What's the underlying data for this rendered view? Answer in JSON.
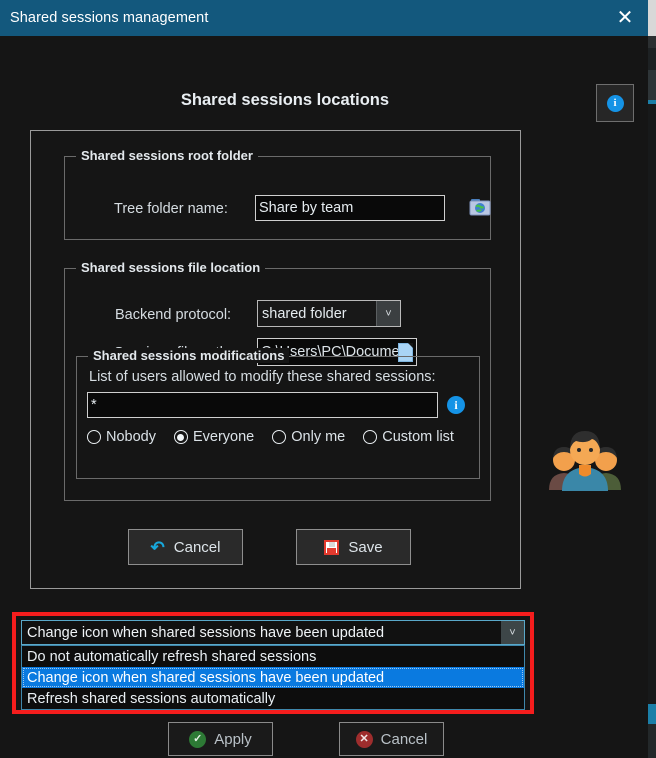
{
  "window": {
    "title": "Shared sessions management",
    "close_icon": "close-icon"
  },
  "header": {
    "page_title": "Shared sessions locations",
    "info_button_glyph": "i"
  },
  "root_folder_group": {
    "legend": "Shared sessions root folder",
    "tree_folder_label": "Tree folder name:",
    "tree_folder_value": "Share by team",
    "browse_icon": "globe-folder-icon"
  },
  "file_location_group": {
    "legend": "Shared sessions file location",
    "backend_protocol_label": "Backend protocol:",
    "backend_protocol_value": "shared folder",
    "backend_protocol_options": [
      "shared folder"
    ],
    "sessions_path_label": "Sessions file path:",
    "sessions_path_value": "C:\\Users\\PC\\Documents\\Share",
    "file_icon": "file-document-icon",
    "dropdown_arrow": "˅"
  },
  "modifications_group": {
    "legend": "Shared sessions modifications",
    "description": "List of users allowed to modify these shared sessions:",
    "users_value": "*",
    "users_placeholder": "",
    "info_glyph": "i",
    "radios": [
      {
        "label": "Nobody",
        "checked": false
      },
      {
        "label": "Everyone",
        "checked": true
      },
      {
        "label": "Only me",
        "checked": false
      },
      {
        "label": "Custom list",
        "checked": false
      }
    ]
  },
  "panel_actions": {
    "cancel_label": "Cancel",
    "cancel_icon": "undo-arrow-icon",
    "save_label": "Save",
    "save_icon": "floppy-disk-icon"
  },
  "refresh_combo": {
    "selected": "Change icon when shared sessions have been updated",
    "arrow": "˅",
    "options": [
      {
        "label": "Do not automatically refresh shared sessions",
        "selected": false
      },
      {
        "label": "Change icon when shared sessions have been updated",
        "selected": true
      },
      {
        "label": "Refresh shared sessions automatically",
        "selected": false
      }
    ],
    "highlight_color": "#f51d1d"
  },
  "dialog_actions": {
    "apply_label": "Apply",
    "apply_icon": "check-circle-icon",
    "cancel_label": "Cancel",
    "cancel_icon": "x-circle-icon"
  },
  "decoration": {
    "people_icon": "people-group-icon"
  },
  "colors": {
    "titlebar": "#13587d",
    "background": "#151515",
    "accent_blue": "#1593e6",
    "selection_blue": "#0a7ae0",
    "highlight_red": "#f51d1d"
  }
}
